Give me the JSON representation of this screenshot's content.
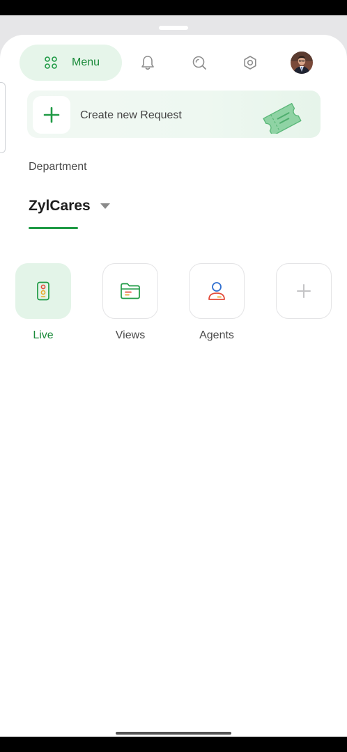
{
  "header": {
    "menu_label": "Menu",
    "icons": [
      "grid-icon",
      "bell-icon",
      "search-icon",
      "settings-icon",
      "avatar"
    ]
  },
  "create_request": {
    "label": "Create new Request",
    "icon": "ticket-icon"
  },
  "department": {
    "label": "Department",
    "selected": "ZylCares"
  },
  "tiles": [
    {
      "label": "Live",
      "icon": "traffic-light-icon",
      "active": true
    },
    {
      "label": "Views",
      "icon": "folder-icon",
      "active": false
    },
    {
      "label": "Agents",
      "icon": "agent-icon",
      "active": false
    },
    {
      "label": "",
      "icon": "add-icon",
      "active": false
    }
  ],
  "colors": {
    "accent": "#1f9a45",
    "accent_light": "#e3f4e8",
    "text": "#1d1d1d",
    "muted": "#4a4a4a"
  }
}
